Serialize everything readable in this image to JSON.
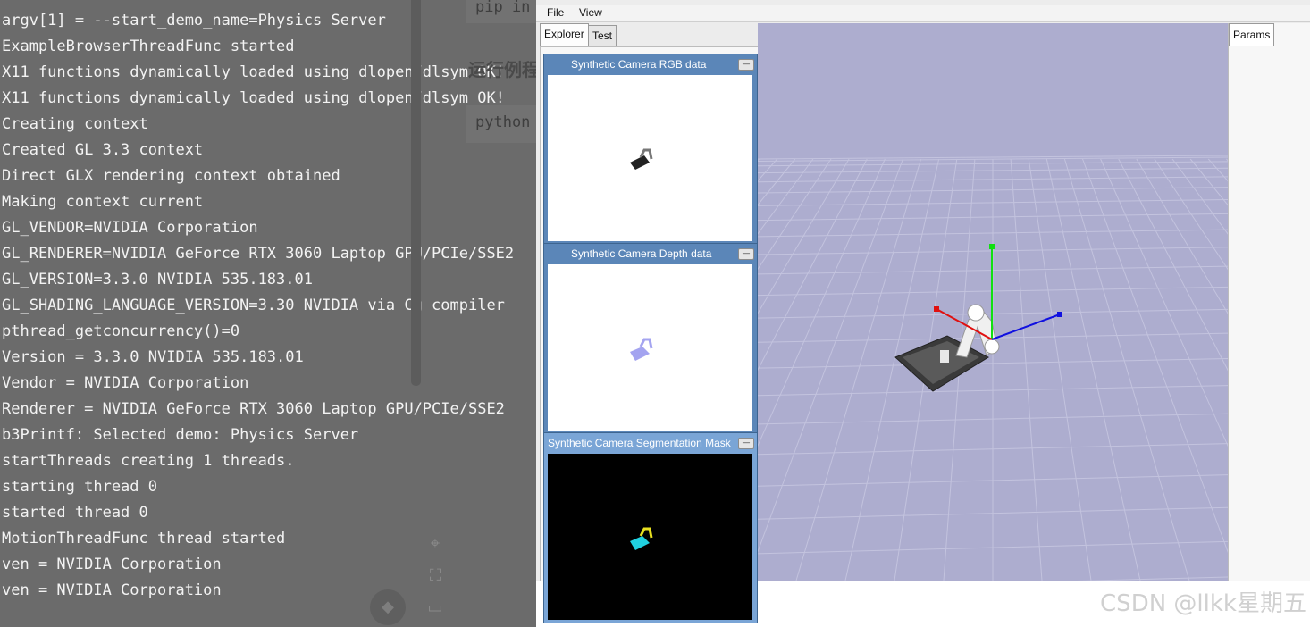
{
  "terminal": {
    "lines": [
      "argv[1] = --start_demo_name=Physics Server",
      "ExampleBrowserThreadFunc started",
      "X11 functions dynamically loaded using dlopen/dlsym OK!",
      "X11 functions dynamically loaded using dlopen/dlsym OK!",
      "Creating context",
      "Created GL 3.3 context",
      "Direct GLX rendering context obtained",
      "Making context current",
      "GL_VENDOR=NVIDIA Corporation",
      "GL_RENDERER=NVIDIA GeForce RTX 3060 Laptop GPU/PCIe/SSE2",
      "GL_VERSION=3.3.0 NVIDIA 535.183.01",
      "GL_SHADING_LANGUAGE_VERSION=3.30 NVIDIA via Cg compiler",
      "pthread_getconcurrency()=0",
      "Version = 3.3.0 NVIDIA 535.183.01",
      "Vendor = NVIDIA Corporation",
      "Renderer = NVIDIA GeForce RTX 3060 Laptop GPU/PCIe/SSE2",
      "b3Printf: Selected demo: Physics Server",
      "startThreads creating 1 threads.",
      "starting thread 0",
      "started thread 0",
      "MotionThreadFunc thread started",
      "ven = NVIDIA Corporation",
      "ven = NVIDIA Corporation"
    ]
  },
  "blog": {
    "code1": "pip in",
    "heading": "运行例程",
    "code2": "python"
  },
  "physics_window": {
    "menu": {
      "file": "File",
      "view": "View"
    },
    "tabs": {
      "explorer": "Explorer",
      "test": "Test"
    },
    "params_tab": "Params",
    "camera_windows": [
      {
        "title": "Synthetic Camera RGB data"
      },
      {
        "title": "Synthetic Camera Depth data"
      },
      {
        "title": "Synthetic Camera Segmentation Mask"
      }
    ],
    "close_glyph": "—",
    "axis_colors": {
      "x": "#e01010",
      "y": "#10e010",
      "z": "#1010e0"
    }
  },
  "icons": [
    "crosshair-icon",
    "fit-view-icon",
    "screen-icon",
    "ai-assistant-icon"
  ],
  "watermark": "CSDN @llkk星期五"
}
